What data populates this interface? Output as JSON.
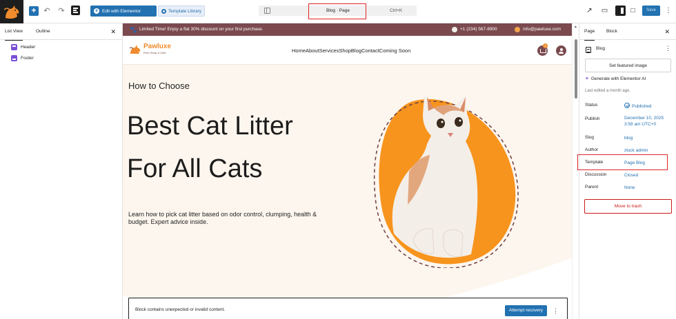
{
  "toolbar": {
    "edit_with_elementor": "Edit with Elementor",
    "template_library": "Template Library",
    "command_title": "Blog · Page",
    "command_shortcut": "Ctrl+K",
    "save_label": "Save"
  },
  "left_panel": {
    "tabs": [
      "List View",
      "Outline"
    ],
    "items": [
      "Header",
      "Footer"
    ]
  },
  "site": {
    "promo_text": "Limited Time! Enjoy a flat 30% discount on your first purchase.",
    "phone": "+1 (234) 567-8900",
    "email": "info@pawluxe.com",
    "brand_name": "Pawluxe",
    "brand_tagline": "Pet's Shop & Care",
    "nav": [
      "Home",
      "About",
      "Services",
      "Shop",
      "Blog",
      "Contact",
      "Coming Soon"
    ],
    "cart_count": "2"
  },
  "hero": {
    "kicker": "How to Choose",
    "line1": "Best Cat Litter",
    "line2": "For All Cats",
    "description": "Learn how to pick cat litter based on odor control, clumping, health & budget. Expert advice inside."
  },
  "invalid_block": {
    "message": "Block contains unexpected or invalid content.",
    "recover_label": "Attempt recovery"
  },
  "right_panel": {
    "tabs": [
      "Page",
      "Block"
    ],
    "doc_title": "Blog",
    "featured_image_label": "Set featured image",
    "ai_label": "Generate with Elementor AI",
    "last_edited": "Last edited a month ago.",
    "meta": {
      "status_label": "Status",
      "status_value": "Published",
      "publish_label": "Publish",
      "publish_value_1": "December 10, 2025",
      "publish_value_2": "3:58 am UTC+0",
      "slug_label": "Slug",
      "slug_value": "blog",
      "author_label": "Author",
      "author_value": "zluck admin",
      "template_label": "Template",
      "template_value": "Page Blog",
      "discussion_label": "Discussion",
      "discussion_value": "Closed",
      "parent_label": "Parent",
      "parent_value": "None"
    },
    "trash_label": "Move to trash"
  },
  "colors": {
    "accent": "#2271b1",
    "brand_brown": "#7a4a4e",
    "brand_orange": "#f08c2d",
    "highlight_red": "#e02424",
    "trash_red": "#cc1818"
  },
  "icons": {
    "site_logo": "wordpress-cat-logo-icon",
    "add": "plus-icon",
    "undo": "undo-icon",
    "redo": "redo-icon",
    "document_overview": "list-view-icon",
    "view_page": "external-link-icon",
    "device_preview": "desktop-icon",
    "settings": "sidebar-settings-icon",
    "comments": "comment-icon",
    "options": "more-vertical-icon"
  }
}
